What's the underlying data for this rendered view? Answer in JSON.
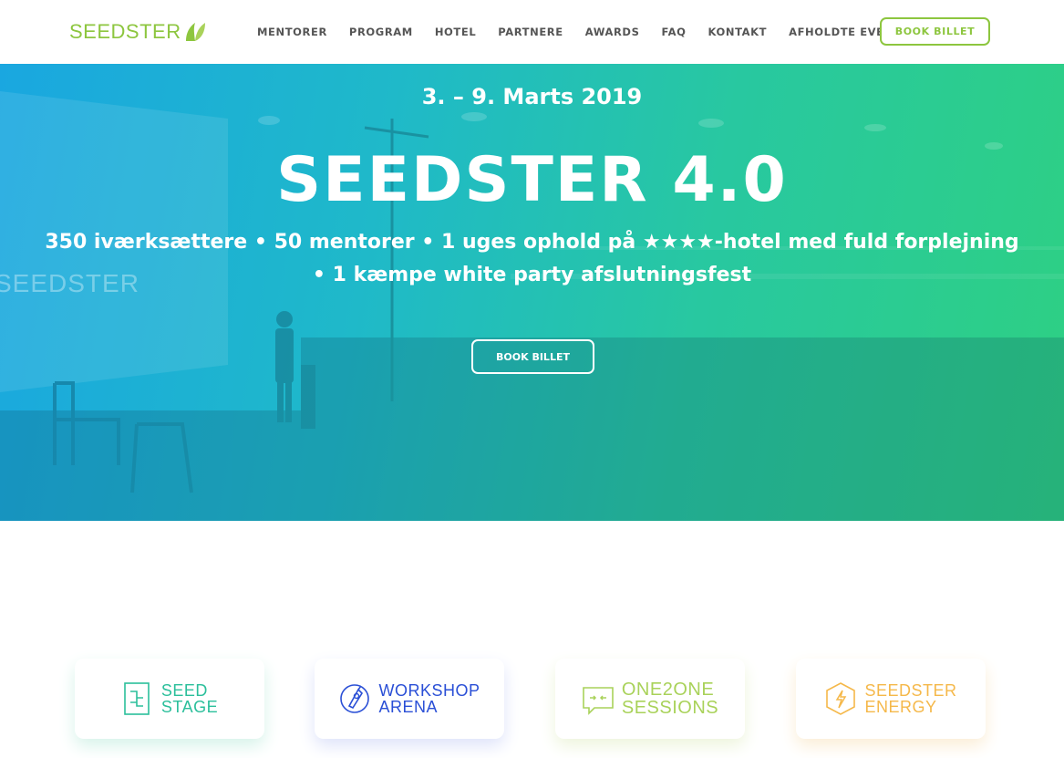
{
  "header": {
    "logo_text": "SEEDSTER",
    "nav": [
      "MENTORER",
      "PROGRAM",
      "HOTEL",
      "PARTNERE",
      "AWARDS",
      "FAQ",
      "KONTAKT",
      "AFHOLDTE EVENTS"
    ],
    "book_label": "BOOK BILLET"
  },
  "hero": {
    "date": "3. – 9. Marts 2019",
    "title": "SEEDSTER 4.0",
    "subtitle_line1": "350 iværksættere • 50 mentorer • 1 uges ophold på ★★★★-hotel med fuld forplejning",
    "subtitle_line2": "• 1 kæmpe white party afslutningsfest",
    "book_label": "BOOK BILLET",
    "screen_logo": "SEEDSTER"
  },
  "cards": [
    {
      "line1": "SEED",
      "line2": "STAGE",
      "icon": "seed-stage-icon",
      "color": "#2bbf9b",
      "shadow": "#d7f3ea"
    },
    {
      "line1": "WORKSHOP",
      "line2": "ARENA",
      "icon": "workshop-arena-icon",
      "color": "#2a4fd6",
      "shadow": "#dfe4fa"
    },
    {
      "line1": "ONE2ONE",
      "line2": "SESSIONS",
      "icon": "one2one-sessions-icon",
      "color": "#a9d25a",
      "shadow": "#eef5dd"
    },
    {
      "line1": "SEEDSTER",
      "line2": "ENERGY",
      "icon": "seedster-energy-icon",
      "color": "#f5b84a",
      "shadow": "#fbeed7"
    }
  ],
  "colors": {
    "brand_green": "#8dc63f",
    "hero_gradient_start": "#1aa7e0",
    "hero_gradient_end": "#2ed083"
  }
}
